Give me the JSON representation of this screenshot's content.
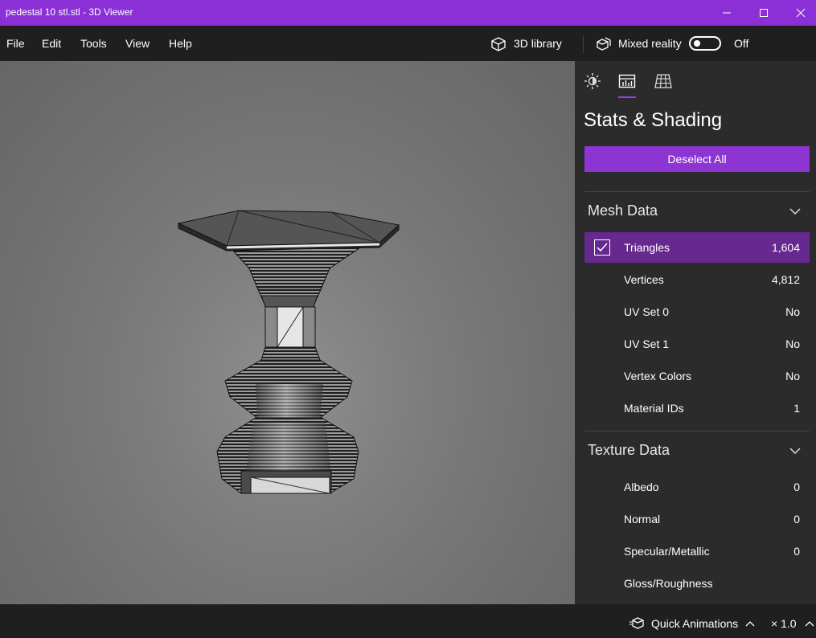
{
  "window": {
    "title": "pedestal 10 stl.stl - 3D Viewer"
  },
  "menu": {
    "file": "File",
    "edit": "Edit",
    "tools": "Tools",
    "view": "View",
    "help": "Help"
  },
  "toolbar": {
    "library_label": "3D library",
    "mixed_reality_label": "Mixed reality",
    "mixed_reality_state": "Off"
  },
  "panel": {
    "tabs": [
      {
        "icon": "lighting-icon",
        "selected": false
      },
      {
        "icon": "stats-icon",
        "selected": true
      },
      {
        "icon": "grid-icon",
        "selected": false
      }
    ],
    "title": "Stats & Shading",
    "deselect_label": "Deselect All",
    "mesh_section": {
      "title": "Mesh Data",
      "rows": [
        {
          "label": "Triangles",
          "value": "1,604",
          "checked": true
        },
        {
          "label": "Vertices",
          "value": "4,812"
        },
        {
          "label": "UV Set 0",
          "value": "No"
        },
        {
          "label": "UV Set 1",
          "value": "No"
        },
        {
          "label": "Vertex Colors",
          "value": "No"
        },
        {
          "label": "Material IDs",
          "value": "1"
        }
      ]
    },
    "texture_section": {
      "title": "Texture Data",
      "rows": [
        {
          "label": "Albedo",
          "value": "0"
        },
        {
          "label": "Normal",
          "value": "0"
        },
        {
          "label": "Specular/Metallic",
          "value": "0"
        },
        {
          "label": "Gloss/Roughness",
          "value": ""
        }
      ]
    }
  },
  "statusbar": {
    "quick_animations_label": "Quick Animations",
    "speed_label": "× 1.0"
  },
  "colors": {
    "accent": "#8d35d3",
    "selected_row": "#66298f",
    "panel_bg": "#2b2b2b",
    "chrome_bg": "#1f1f1f"
  }
}
